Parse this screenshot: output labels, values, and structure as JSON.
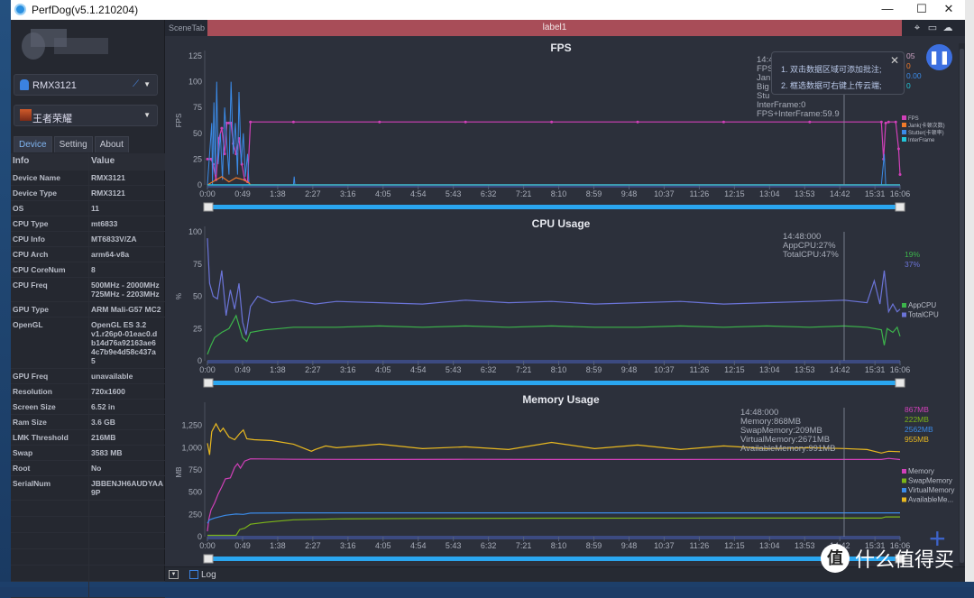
{
  "window": {
    "title": "PerfDog(v5.1.210204)",
    "min": "—",
    "max": "☐",
    "close": "✕"
  },
  "sidebar": {
    "device": "RMX3121",
    "app": "王者荣耀",
    "tabs": [
      {
        "label": "Device"
      },
      {
        "label": "Setting"
      },
      {
        "label": "About"
      }
    ],
    "table_headers": [
      "Info",
      "Value"
    ],
    "rows": [
      [
        "Device Name",
        "RMX3121"
      ],
      [
        "Device Type",
        "RMX3121"
      ],
      [
        "OS",
        "11"
      ],
      [
        "CPU Type",
        "mt6833"
      ],
      [
        "CPU Info",
        "MT6833V/ZA"
      ],
      [
        "CPU Arch",
        "arm64-v8a"
      ],
      [
        "CPU CoreNum",
        "8"
      ],
      [
        "CPU Freq",
        "500MHz - 2000MHz\n725MHz - 2203MHz"
      ],
      [
        "GPU Type",
        "ARM Mali-G57 MC2"
      ],
      [
        "OpenGL",
        "OpenGL ES 3.2\nv1.r26p0-01eac0.d\nb14d76a92163ae6\n4c7b9e4d58c437a\n5"
      ],
      [
        "GPU Freq",
        "unavailable"
      ],
      [
        "Resolution",
        "720x1600"
      ],
      [
        "Screen Size",
        "6.52 in"
      ],
      [
        "Ram Size",
        "3.6 GB"
      ],
      [
        "LMK Threshold",
        "216MB"
      ],
      [
        "Swap",
        "3583 MB"
      ],
      [
        "Root",
        "No"
      ],
      [
        "SerialNum",
        "JBBENJH6AUDYAA\n9P"
      ]
    ]
  },
  "topbar": {
    "scene_tab": "SceneTab",
    "label": "label1",
    "icons": [
      "location-icon",
      "folder-icon",
      "cloud-icon"
    ]
  },
  "popup": {
    "line1": "1. 双击数据区域可添加批注;",
    "line2": "2. 框选数据可右键上传云端;",
    "close": "✕"
  },
  "bottom": {
    "log_label": "Log",
    "log_checked": false
  },
  "watermark": {
    "text": "什么值得买",
    "badge": "值"
  },
  "chart_data": [
    {
      "type": "line",
      "title": "FPS",
      "ylabel": "FPS",
      "ylim": [
        0,
        125
      ],
      "yticks": [
        "0",
        "25",
        "50",
        "75",
        "100",
        "125"
      ],
      "xticks": [
        "0:00",
        "0:49",
        "1:38",
        "2:27",
        "3:16",
        "4:05",
        "4:54",
        "5:43",
        "6:32",
        "7:21",
        "8:10",
        "8:59",
        "9:48",
        "10:37",
        "11:26",
        "12:15",
        "13:04",
        "13:53",
        "14:42",
        "15:31",
        "16:06"
      ],
      "xlim": [
        "0:00",
        "16:06"
      ],
      "cursor": "14:48",
      "tooltip": [
        "14:4",
        "FPS",
        "Jan",
        "Big",
        "Stu",
        "InterFrame:0",
        "FPS+InterFrame:59.9"
      ],
      "right_values": [
        {
          "text": "05",
          "color": "#c9a0c0"
        },
        {
          "text": "0",
          "color": "#f07a2a"
        },
        {
          "text": "0.00",
          "color": "#3b8be8"
        },
        {
          "text": "0",
          "color": "#22c4d8"
        }
      ],
      "legend": [
        "FPS",
        "Jank(卡顿次数)",
        "Stutter(卡顿率)",
        "InterFrame"
      ],
      "series": [
        {
          "name": "FPS",
          "color": "#d040b8",
          "x": [
            "0:00",
            "0:05",
            "0:08",
            "0:12",
            "0:16",
            "0:20",
            "0:24",
            "0:27",
            "0:30",
            "0:33",
            "0:36",
            "0:40",
            "0:44",
            "0:48",
            "0:52",
            "0:56",
            "1:00",
            "2:00",
            "4:00",
            "6:00",
            "8:00",
            "10:00",
            "12:00",
            "14:00",
            "15:40",
            "15:43",
            "15:46",
            "15:50",
            "16:00",
            "16:04",
            "16:06"
          ],
          "y": [
            25,
            25,
            20,
            5,
            45,
            55,
            30,
            60,
            60,
            60,
            40,
            30,
            45,
            20,
            5,
            3,
            61,
            61,
            61,
            61,
            61,
            61,
            61,
            61,
            61,
            25,
            60,
            61,
            61,
            35,
            10
          ]
        },
        {
          "name": "Stutter(卡顿率)",
          "color": "#3b8be8",
          "x": [
            "0:00",
            "0:06",
            "0:07",
            "0:09",
            "0:11",
            "0:13",
            "0:15",
            "0:18",
            "0:21",
            "0:24",
            "0:27",
            "0:30",
            "0:33",
            "0:36",
            "0:39",
            "0:42",
            "0:44",
            "0:47",
            "0:50",
            "0:53",
            "0:56",
            "0:58",
            "1:00",
            "1:30",
            "2:00",
            "2:01",
            "2:02",
            "3:00",
            "8:00",
            "15:40",
            "15:44",
            "15:46",
            "15:48",
            "16:06"
          ],
          "y": [
            0,
            60,
            0,
            80,
            10,
            100,
            20,
            50,
            5,
            75,
            40,
            10,
            100,
            30,
            60,
            10,
            90,
            20,
            50,
            8,
            30,
            0,
            0,
            0,
            0,
            8,
            0,
            0,
            0,
            0,
            30,
            0,
            0,
            0
          ]
        },
        {
          "name": "Jank(卡顿次数)",
          "color": "#f07a2a",
          "x": [
            "0:00",
            "0:10",
            "0:20",
            "0:30",
            "0:40",
            "0:50",
            "0:58",
            "1:00",
            "16:06"
          ],
          "y": [
            0,
            4,
            8,
            3,
            7,
            5,
            2,
            0,
            0
          ]
        },
        {
          "name": "InterFrame",
          "color": "#22c4d8",
          "x": [
            "0:00",
            "16:06"
          ],
          "y": [
            0,
            0
          ]
        }
      ]
    },
    {
      "type": "line",
      "title": "CPU Usage",
      "ylabel": "%",
      "ylim": [
        0,
        100
      ],
      "yticks": [
        "0",
        "25",
        "50",
        "75",
        "100"
      ],
      "xticks": [
        "0:00",
        "0:49",
        "1:38",
        "2:27",
        "3:16",
        "4:05",
        "4:54",
        "5:43",
        "6:32",
        "7:21",
        "8:10",
        "8:59",
        "9:48",
        "10:37",
        "11:26",
        "12:15",
        "13:04",
        "13:53",
        "14:42",
        "15:31",
        "16:06"
      ],
      "xlim": [
        "0:00",
        "16:06"
      ],
      "cursor": "14:48",
      "tooltip": [
        "14:48:000",
        "AppCPU:27%",
        "TotalCPU:47%"
      ],
      "right_values": [
        {
          "text": "19%",
          "color": "#3cb44b"
        },
        {
          "text": "37%",
          "color": "#6b74d8"
        }
      ],
      "legend": [
        "AppCPU",
        "TotalCPU"
      ],
      "series": [
        {
          "name": "TotalCPU",
          "color": "#6b74d8",
          "x": [
            "0:00",
            "0:03",
            "0:08",
            "0:14",
            "0:20",
            "0:26",
            "0:32",
            "0:38",
            "0:44",
            "0:49",
            "0:54",
            "1:00",
            "1:10",
            "1:30",
            "2:00",
            "2:30",
            "3:00",
            "4:00",
            "5:00",
            "6:00",
            "7:00",
            "8:00",
            "9:00",
            "10:00",
            "11:00",
            "12:00",
            "13:00",
            "14:00",
            "14:48",
            "15:20",
            "15:30",
            "15:38",
            "15:44",
            "15:50",
            "15:56",
            "16:02",
            "16:06"
          ],
          "y": [
            95,
            60,
            50,
            48,
            70,
            35,
            55,
            40,
            60,
            30,
            20,
            42,
            50,
            45,
            47,
            44,
            46,
            45,
            44,
            47,
            45,
            46,
            44,
            45,
            46,
            44,
            45,
            46,
            47,
            45,
            62,
            44,
            70,
            38,
            44,
            38,
            40
          ]
        },
        {
          "name": "AppCPU",
          "color": "#3cb44b",
          "x": [
            "0:00",
            "0:05",
            "0:10",
            "0:20",
            "0:30",
            "0:40",
            "0:49",
            "0:55",
            "1:00",
            "1:20",
            "1:40",
            "2:00",
            "3:00",
            "4:00",
            "5:00",
            "6:00",
            "7:00",
            "8:00",
            "9:00",
            "10:00",
            "11:00",
            "12:00",
            "13:00",
            "14:00",
            "14:48",
            "15:20",
            "15:40",
            "15:44",
            "15:48",
            "15:56",
            "16:02",
            "16:06"
          ],
          "y": [
            5,
            12,
            18,
            22,
            25,
            35,
            18,
            15,
            22,
            24,
            25,
            26,
            26,
            27,
            26,
            27,
            26,
            27,
            26,
            26,
            27,
            26,
            27,
            26,
            27,
            26,
            24,
            12,
            25,
            22,
            26,
            19
          ]
        }
      ]
    },
    {
      "type": "line",
      "title": "Memory Usage",
      "ylabel": "MB",
      "ylim": [
        0,
        1450
      ],
      "yticks": [
        "0",
        "250",
        "500",
        "750",
        "1,000",
        "1,250"
      ],
      "xticks": [
        "0:00",
        "0:49",
        "1:38",
        "2:27",
        "3:16",
        "4:05",
        "4:54",
        "5:43",
        "6:32",
        "7:21",
        "8:10",
        "8:59",
        "9:48",
        "10:37",
        "11:26",
        "12:15",
        "13:04",
        "13:53",
        "14:42",
        "15:31",
        "16:06"
      ],
      "xlim": [
        "0:00",
        "16:06"
      ],
      "cursor": "14:48",
      "tooltip": [
        "14:48:000",
        "Memory:868MB",
        "SwapMemory:209MB",
        "VirtualMemory:2671MB",
        "AvailableMemory:991MB"
      ],
      "right_values": [
        {
          "text": "867MB",
          "color": "#d040b8"
        },
        {
          "text": "222MB",
          "color": "#7cb518"
        },
        {
          "text": "2562MB",
          "color": "#3b8be8"
        },
        {
          "text": "955MB",
          "color": "#e8b820"
        }
      ],
      "legend": [
        "Memory",
        "SwapMemory",
        "VirtualMemory",
        "AvailableMe..."
      ],
      "series": [
        {
          "name": "Memory",
          "color": "#d040b8",
          "x": [
            "0:00",
            "0:02",
            "0:05",
            "0:10",
            "0:15",
            "0:20",
            "0:25",
            "0:32",
            "0:38",
            "0:42",
            "0:46",
            "0:52",
            "1:00",
            "2:00",
            "4:00",
            "6:00",
            "8:00",
            "10:00",
            "12:00",
            "14:00",
            "15:40",
            "15:50",
            "16:06"
          ],
          "y": [
            60,
            200,
            300,
            380,
            480,
            560,
            650,
            660,
            780,
            820,
            770,
            850,
            875,
            870,
            868,
            870,
            868,
            868,
            869,
            868,
            868,
            880,
            867
          ]
        },
        {
          "name": "SwapMemory",
          "color": "#7cb518",
          "x": [
            "0:00",
            "0:40",
            "0:45",
            "0:52",
            "1:00",
            "1:20",
            "1:40",
            "2:00",
            "3:00",
            "5:00",
            "8:00",
            "12:00",
            "14:48",
            "15:40",
            "15:46",
            "16:06"
          ],
          "y": [
            15,
            15,
            80,
            95,
            140,
            160,
            175,
            190,
            200,
            205,
            208,
            209,
            209,
            209,
            222,
            222
          ]
        },
        {
          "name": "VirtualMemory",
          "color": "#3b8be8",
          "x": [
            "0:00",
            "0:03",
            "0:10",
            "0:25",
            "0:40",
            "0:50",
            "1:00",
            "2:00",
            "8:00",
            "16:06"
          ],
          "y": [
            150,
            190,
            210,
            240,
            255,
            250,
            265,
            268,
            268,
            268
          ]
        },
        {
          "name": "AvailableMemory",
          "color": "#e8b820",
          "x": [
            "0:00",
            "0:03",
            "0:06",
            "0:12",
            "0:18",
            "0:22",
            "0:30",
            "0:38",
            "0:45",
            "0:50",
            "0:55",
            "1:05",
            "1:30",
            "2:00",
            "2:25",
            "2:30",
            "2:45",
            "3:00",
            "4:00",
            "5:00",
            "6:00",
            "7:00",
            "8:00",
            "9:00",
            "10:00",
            "11:00",
            "12:00",
            "13:00",
            "14:00",
            "14:48",
            "15:20",
            "15:40",
            "15:50",
            "16:06"
          ],
          "y": [
            1050,
            920,
            1180,
            1270,
            1180,
            1220,
            1120,
            1090,
            1160,
            1200,
            1100,
            1090,
            1080,
            1040,
            960,
            980,
            1020,
            1000,
            1040,
            990,
            1010,
            980,
            1060,
            990,
            1030,
            980,
            1020,
            990,
            1000,
            991,
            980,
            940,
            960,
            955
          ]
        }
      ]
    }
  ]
}
